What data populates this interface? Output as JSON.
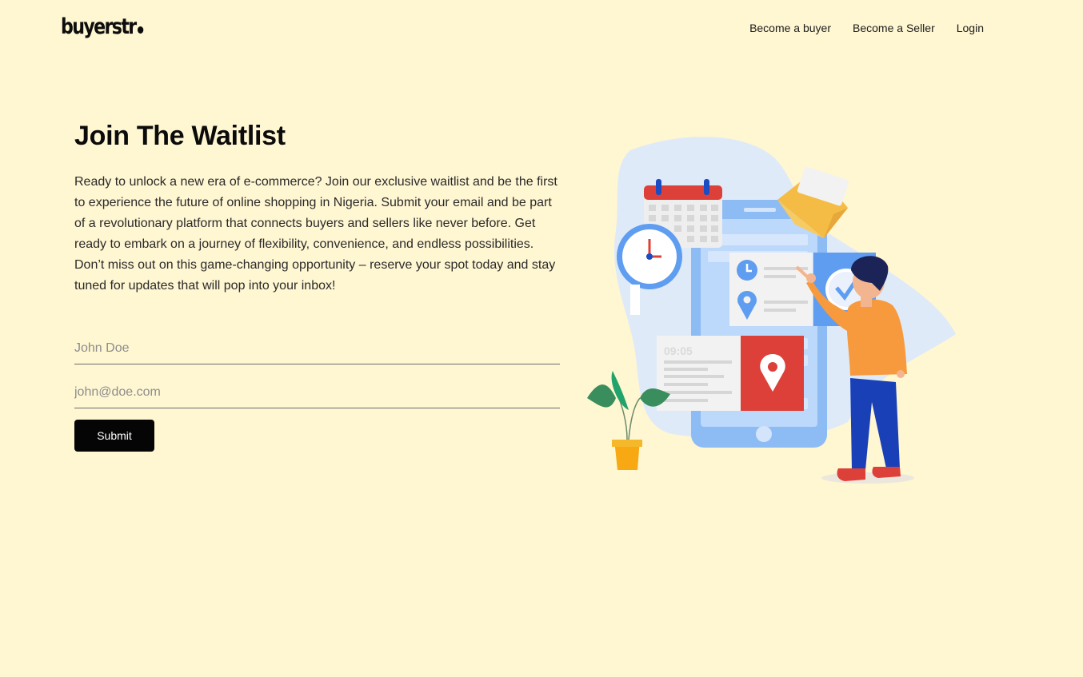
{
  "brand": {
    "name": "buyerstr"
  },
  "nav": {
    "items": [
      {
        "label": "Become a buyer"
      },
      {
        "label": "Become a Seller"
      },
      {
        "label": "Login"
      }
    ]
  },
  "hero": {
    "title": "Join The Waitlist",
    "description": "Ready to unlock a new era of e-commerce? Join our exclusive waitlist and be the first to experience the future of online shopping in Nigeria. Submit your email and be part of a revolutionary platform that connects buyers and sellers like never before. Get ready to embark on a journey of flexibility, convenience, and endless possibilities. Don’t miss out on this game-changing opportunity – reserve your spot today and stay tuned for updates that will pop into your inbox!"
  },
  "form": {
    "name_placeholder": "John Doe",
    "email_placeholder": "john@doe.com",
    "submit_label": "Submit"
  },
  "illustration": {
    "clock_text": "09:05"
  },
  "colors": {
    "background": "#fff6d2",
    "button": "#050505",
    "phone": "#8dbcf5",
    "accent_red": "#dc4039",
    "shirt": "#f79a3e",
    "pants": "#1a40b8"
  }
}
